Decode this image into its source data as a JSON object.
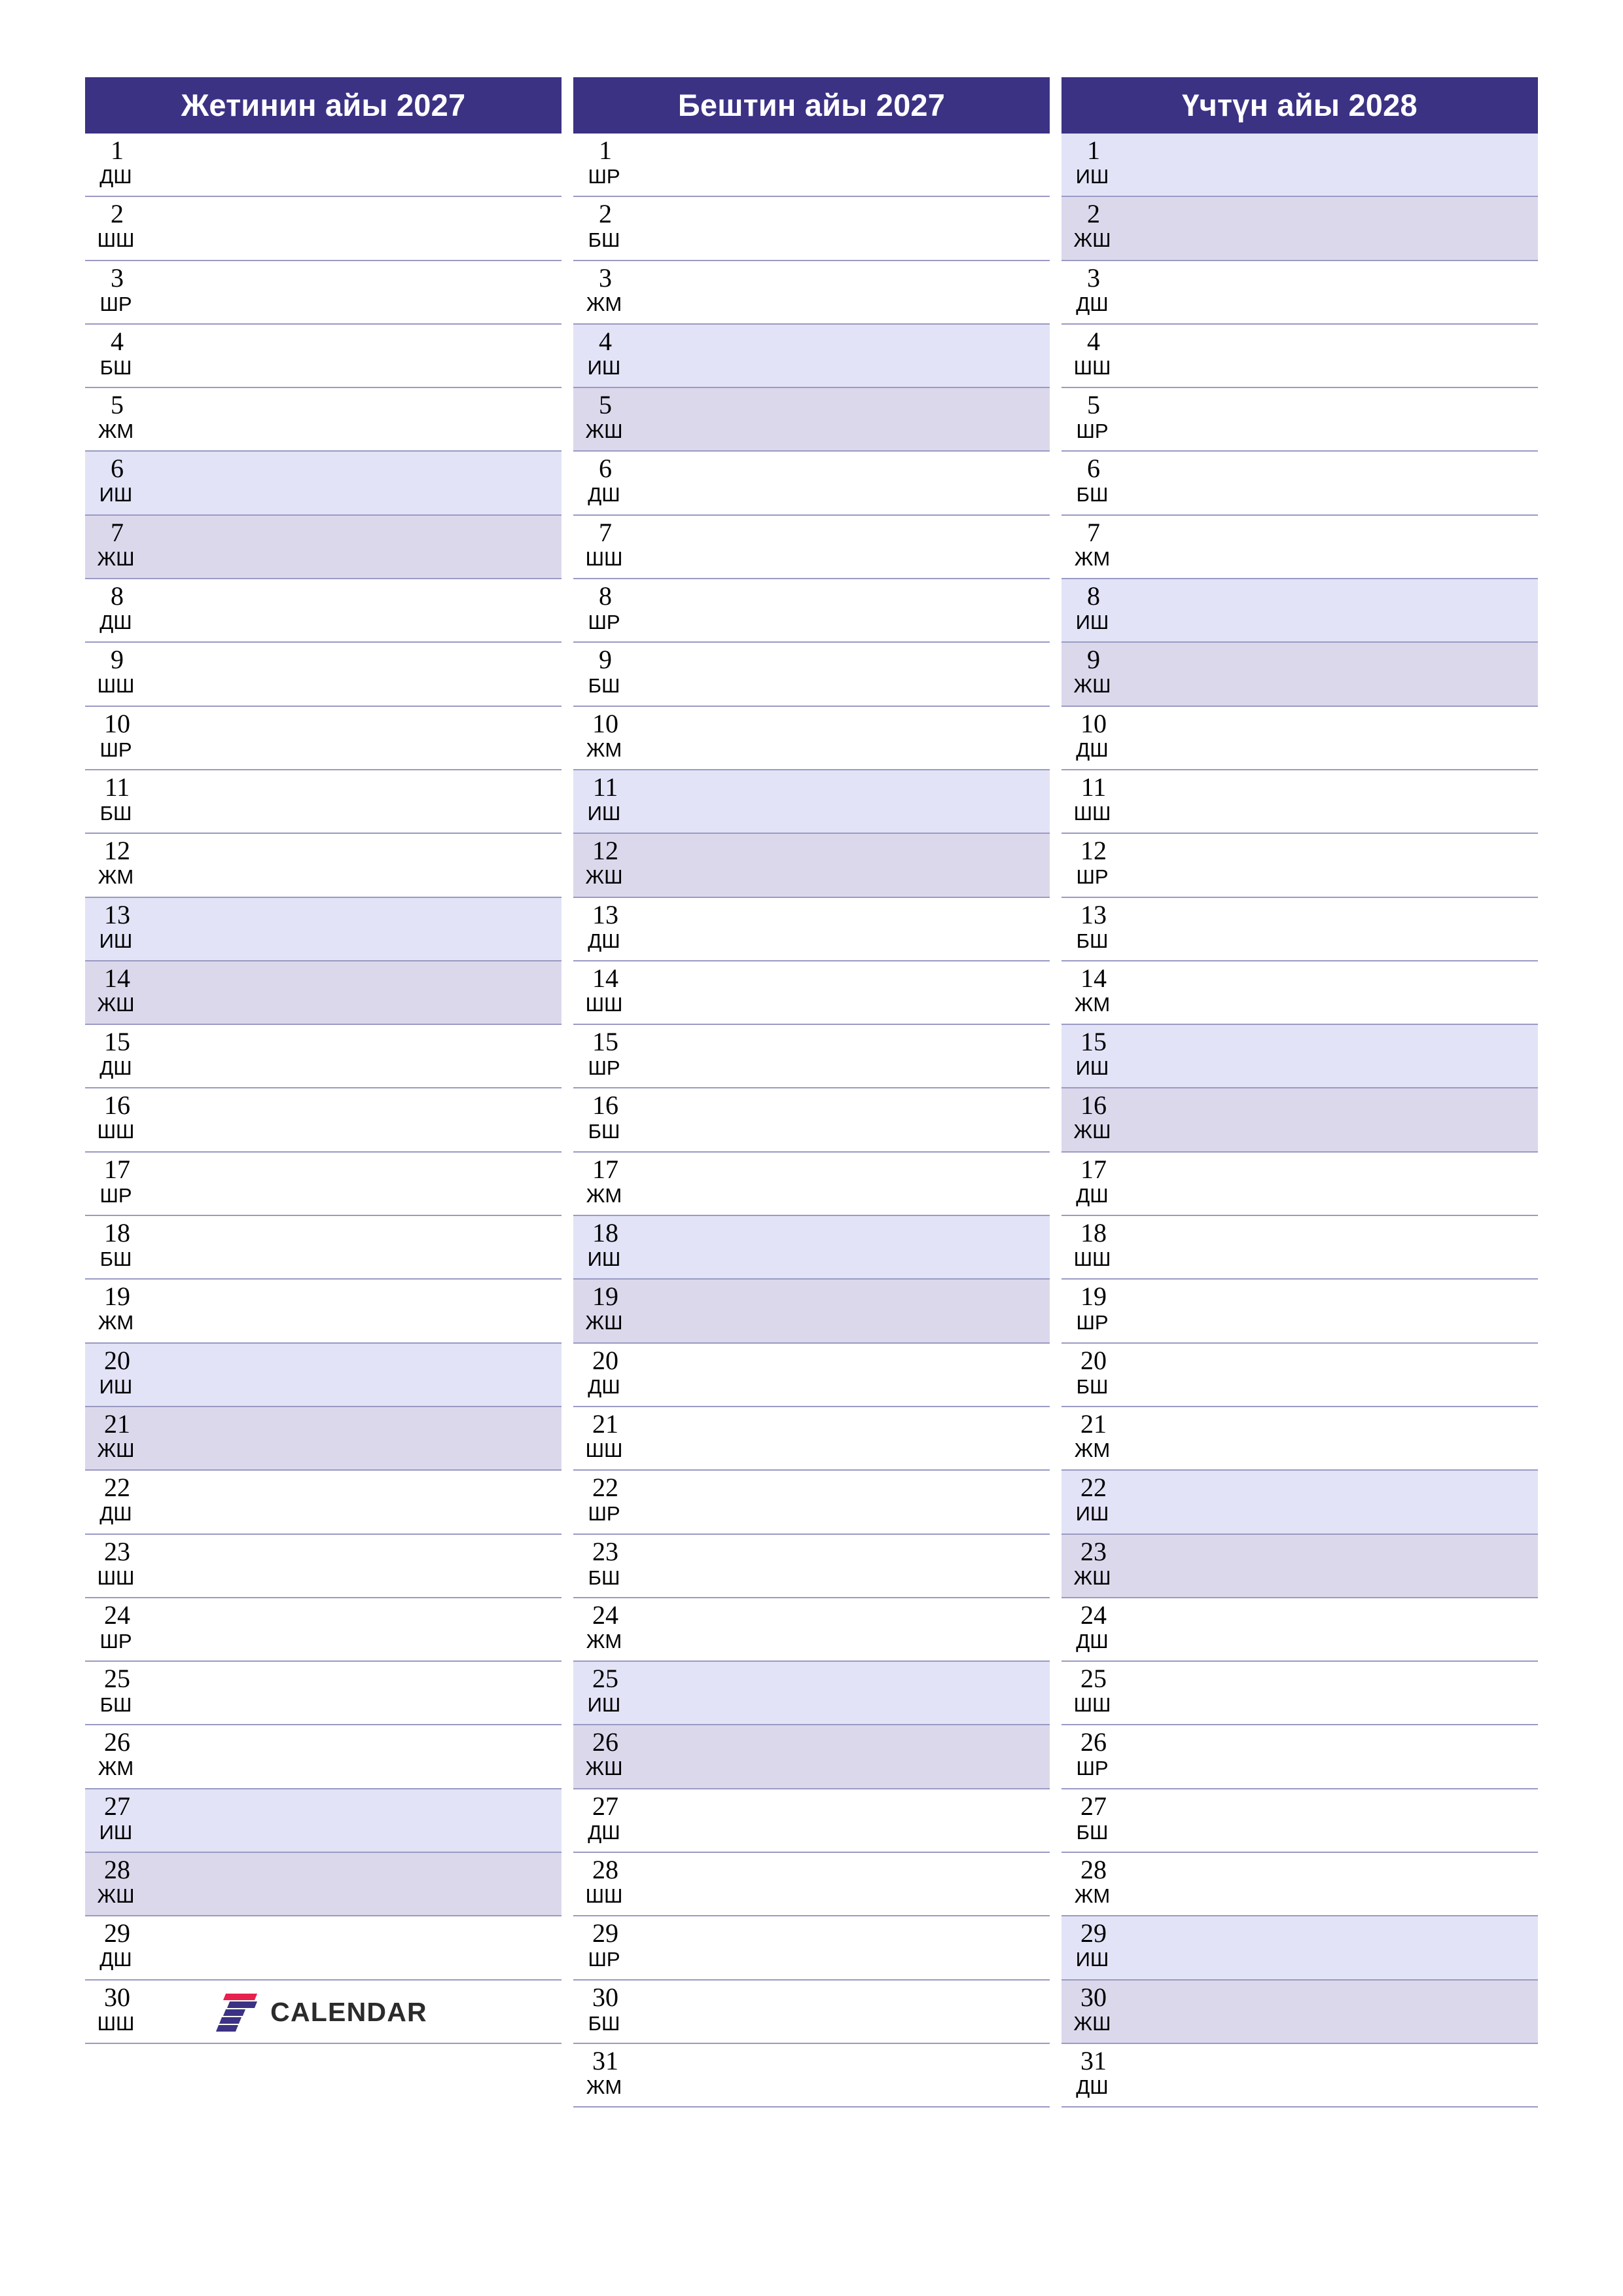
{
  "meta": {
    "layout": "three-month-vertical-planner",
    "accent_color": "#3b3284",
    "saturday_color": "#e2e3f6",
    "sunday_color": "#dcd8ec",
    "row_line_color": "#9a9ac4",
    "page_background": "#ffffff"
  },
  "weekday_codes": {
    "mon": "ДШ",
    "tue": "ШШ",
    "wed": "ШР",
    "thu": "БШ",
    "fri": "ЖМ",
    "sat": "ИШ",
    "sun": "ЖШ"
  },
  "branding": {
    "name": "CALENDAR",
    "mark": "seven-logo-icon",
    "mark_colors": [
      "#e8204e",
      "#3b3284"
    ]
  },
  "months": [
    {
      "title": "Жетинин айы 2027",
      "days": [
        {
          "n": "1",
          "wd": "ДШ",
          "type": "weekday"
        },
        {
          "n": "2",
          "wd": "ШШ",
          "type": "weekday"
        },
        {
          "n": "3",
          "wd": "ШР",
          "type": "weekday"
        },
        {
          "n": "4",
          "wd": "БШ",
          "type": "weekday"
        },
        {
          "n": "5",
          "wd": "ЖМ",
          "type": "weekday"
        },
        {
          "n": "6",
          "wd": "ИШ",
          "type": "sat"
        },
        {
          "n": "7",
          "wd": "ЖШ",
          "type": "sun"
        },
        {
          "n": "8",
          "wd": "ДШ",
          "type": "weekday"
        },
        {
          "n": "9",
          "wd": "ШШ",
          "type": "weekday"
        },
        {
          "n": "10",
          "wd": "ШР",
          "type": "weekday"
        },
        {
          "n": "11",
          "wd": "БШ",
          "type": "weekday"
        },
        {
          "n": "12",
          "wd": "ЖМ",
          "type": "weekday"
        },
        {
          "n": "13",
          "wd": "ИШ",
          "type": "sat"
        },
        {
          "n": "14",
          "wd": "ЖШ",
          "type": "sun"
        },
        {
          "n": "15",
          "wd": "ДШ",
          "type": "weekday"
        },
        {
          "n": "16",
          "wd": "ШШ",
          "type": "weekday"
        },
        {
          "n": "17",
          "wd": "ШР",
          "type": "weekday"
        },
        {
          "n": "18",
          "wd": "БШ",
          "type": "weekday"
        },
        {
          "n": "19",
          "wd": "ЖМ",
          "type": "weekday"
        },
        {
          "n": "20",
          "wd": "ИШ",
          "type": "sat"
        },
        {
          "n": "21",
          "wd": "ЖШ",
          "type": "sun"
        },
        {
          "n": "22",
          "wd": "ДШ",
          "type": "weekday"
        },
        {
          "n": "23",
          "wd": "ШШ",
          "type": "weekday"
        },
        {
          "n": "24",
          "wd": "ШР",
          "type": "weekday"
        },
        {
          "n": "25",
          "wd": "БШ",
          "type": "weekday"
        },
        {
          "n": "26",
          "wd": "ЖМ",
          "type": "weekday"
        },
        {
          "n": "27",
          "wd": "ИШ",
          "type": "sat"
        },
        {
          "n": "28",
          "wd": "ЖШ",
          "type": "sun"
        },
        {
          "n": "29",
          "wd": "ДШ",
          "type": "weekday"
        },
        {
          "n": "30",
          "wd": "ШШ",
          "type": "weekday"
        }
      ]
    },
    {
      "title": "Бештин айы 2027",
      "days": [
        {
          "n": "1",
          "wd": "ШР",
          "type": "weekday"
        },
        {
          "n": "2",
          "wd": "БШ",
          "type": "weekday"
        },
        {
          "n": "3",
          "wd": "ЖМ",
          "type": "weekday"
        },
        {
          "n": "4",
          "wd": "ИШ",
          "type": "sat"
        },
        {
          "n": "5",
          "wd": "ЖШ",
          "type": "sun"
        },
        {
          "n": "6",
          "wd": "ДШ",
          "type": "weekday"
        },
        {
          "n": "7",
          "wd": "ШШ",
          "type": "weekday"
        },
        {
          "n": "8",
          "wd": "ШР",
          "type": "weekday"
        },
        {
          "n": "9",
          "wd": "БШ",
          "type": "weekday"
        },
        {
          "n": "10",
          "wd": "ЖМ",
          "type": "weekday"
        },
        {
          "n": "11",
          "wd": "ИШ",
          "type": "sat"
        },
        {
          "n": "12",
          "wd": "ЖШ",
          "type": "sun"
        },
        {
          "n": "13",
          "wd": "ДШ",
          "type": "weekday"
        },
        {
          "n": "14",
          "wd": "ШШ",
          "type": "weekday"
        },
        {
          "n": "15",
          "wd": "ШР",
          "type": "weekday"
        },
        {
          "n": "16",
          "wd": "БШ",
          "type": "weekday"
        },
        {
          "n": "17",
          "wd": "ЖМ",
          "type": "weekday"
        },
        {
          "n": "18",
          "wd": "ИШ",
          "type": "sat"
        },
        {
          "n": "19",
          "wd": "ЖШ",
          "type": "sun"
        },
        {
          "n": "20",
          "wd": "ДШ",
          "type": "weekday"
        },
        {
          "n": "21",
          "wd": "ШШ",
          "type": "weekday"
        },
        {
          "n": "22",
          "wd": "ШР",
          "type": "weekday"
        },
        {
          "n": "23",
          "wd": "БШ",
          "type": "weekday"
        },
        {
          "n": "24",
          "wd": "ЖМ",
          "type": "weekday"
        },
        {
          "n": "25",
          "wd": "ИШ",
          "type": "sat"
        },
        {
          "n": "26",
          "wd": "ЖШ",
          "type": "sun"
        },
        {
          "n": "27",
          "wd": "ДШ",
          "type": "weekday"
        },
        {
          "n": "28",
          "wd": "ШШ",
          "type": "weekday"
        },
        {
          "n": "29",
          "wd": "ШР",
          "type": "weekday"
        },
        {
          "n": "30",
          "wd": "БШ",
          "type": "weekday"
        },
        {
          "n": "31",
          "wd": "ЖМ",
          "type": "weekday"
        }
      ]
    },
    {
      "title": "Үчтүн айы 2028",
      "days": [
        {
          "n": "1",
          "wd": "ИШ",
          "type": "sat"
        },
        {
          "n": "2",
          "wd": "ЖШ",
          "type": "sun"
        },
        {
          "n": "3",
          "wd": "ДШ",
          "type": "weekday"
        },
        {
          "n": "4",
          "wd": "ШШ",
          "type": "weekday"
        },
        {
          "n": "5",
          "wd": "ШР",
          "type": "weekday"
        },
        {
          "n": "6",
          "wd": "БШ",
          "type": "weekday"
        },
        {
          "n": "7",
          "wd": "ЖМ",
          "type": "weekday"
        },
        {
          "n": "8",
          "wd": "ИШ",
          "type": "sat"
        },
        {
          "n": "9",
          "wd": "ЖШ",
          "type": "sun"
        },
        {
          "n": "10",
          "wd": "ДШ",
          "type": "weekday"
        },
        {
          "n": "11",
          "wd": "ШШ",
          "type": "weekday"
        },
        {
          "n": "12",
          "wd": "ШР",
          "type": "weekday"
        },
        {
          "n": "13",
          "wd": "БШ",
          "type": "weekday"
        },
        {
          "n": "14",
          "wd": "ЖМ",
          "type": "weekday"
        },
        {
          "n": "15",
          "wd": "ИШ",
          "type": "sat"
        },
        {
          "n": "16",
          "wd": "ЖШ",
          "type": "sun"
        },
        {
          "n": "17",
          "wd": "ДШ",
          "type": "weekday"
        },
        {
          "n": "18",
          "wd": "ШШ",
          "type": "weekday"
        },
        {
          "n": "19",
          "wd": "ШР",
          "type": "weekday"
        },
        {
          "n": "20",
          "wd": "БШ",
          "type": "weekday"
        },
        {
          "n": "21",
          "wd": "ЖМ",
          "type": "weekday"
        },
        {
          "n": "22",
          "wd": "ИШ",
          "type": "sat"
        },
        {
          "n": "23",
          "wd": "ЖШ",
          "type": "sun"
        },
        {
          "n": "24",
          "wd": "ДШ",
          "type": "weekday"
        },
        {
          "n": "25",
          "wd": "ШШ",
          "type": "weekday"
        },
        {
          "n": "26",
          "wd": "ШР",
          "type": "weekday"
        },
        {
          "n": "27",
          "wd": "БШ",
          "type": "weekday"
        },
        {
          "n": "28",
          "wd": "ЖМ",
          "type": "weekday"
        },
        {
          "n": "29",
          "wd": "ИШ",
          "type": "sat"
        },
        {
          "n": "30",
          "wd": "ЖШ",
          "type": "sun"
        },
        {
          "n": "31",
          "wd": "ДШ",
          "type": "weekday"
        }
      ]
    }
  ]
}
